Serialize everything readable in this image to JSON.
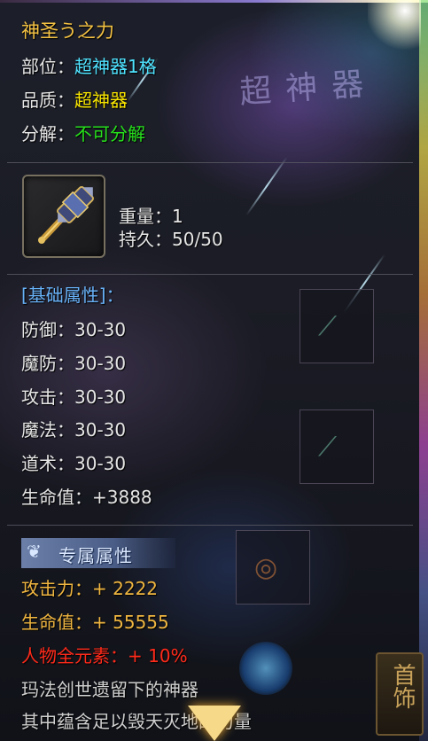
{
  "item": {
    "name": "神圣う之力",
    "slot_label": "部位：",
    "slot_value": "超神器1格",
    "quality_label": "品质：",
    "quality_value": "超神器",
    "decompose_label": "分解：",
    "decompose_value": "不可分解",
    "icon": "hammer-icon",
    "weight_label": "重量：",
    "weight_value": "1",
    "durability_label": "持久：",
    "durability_value": "50/50"
  },
  "watermark": "超神器",
  "base_attributes": {
    "header": "[基础属性]：",
    "rows": [
      {
        "label": "防御：",
        "value": "30-30"
      },
      {
        "label": "魔防：",
        "value": "30-30"
      },
      {
        "label": "攻击：",
        "value": "30-30"
      },
      {
        "label": "魔法：",
        "value": "30-30"
      },
      {
        "label": "道术：",
        "value": "30-30"
      },
      {
        "label": "生命值：",
        "value": "+3888"
      }
    ]
  },
  "exclusive_attributes": {
    "header": "专属属性",
    "rows": [
      {
        "text": "攻击力：+ 2222",
        "color": "#f0b640"
      },
      {
        "text": "生命值：+ 55555",
        "color": "#f0b640"
      },
      {
        "text": "人物全元素：+ 10%",
        "color": "#ff2a1a"
      }
    ]
  },
  "description": [
    "玛法创世遗留下的神器",
    "其中蕴含足以毁天灭地的力量"
  ],
  "side_ornament": "首饰",
  "colors": {
    "title": "#f4c243",
    "cyan": "#4fe3ff",
    "yellow": "#f7e400",
    "green": "#27e01c",
    "section_blue": "#67b0f5"
  }
}
